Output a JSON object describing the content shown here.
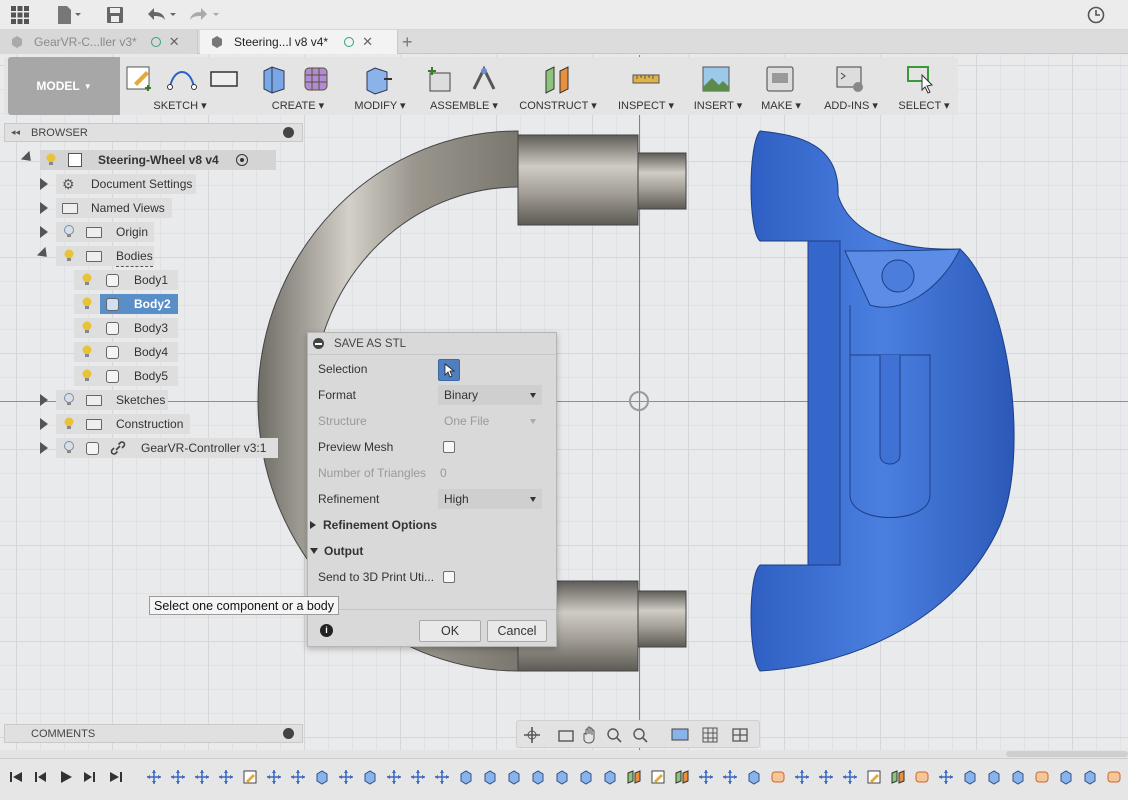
{
  "tabs": [
    {
      "label": "GearVR-C...ller v3*",
      "state": "inactive"
    },
    {
      "label": "Steering...l v8 v4*",
      "state": "active"
    }
  ],
  "toolbar": {
    "mode_label": "MODEL",
    "groups": [
      "SKETCH",
      "CREATE",
      "MODIFY",
      "ASSEMBLE",
      "CONSTRUCT",
      "INSPECT",
      "INSERT",
      "MAKE",
      "ADD-INS",
      "SELECT"
    ]
  },
  "browser": {
    "title": "BROWSER",
    "root": "Steering-Wheel v8 v4",
    "items": {
      "document_settings": "Document Settings",
      "named_views": "Named Views",
      "origin": "Origin",
      "bodies": "Bodies",
      "body1": "Body1",
      "body2": "Body2",
      "body3": "Body3",
      "body4": "Body4",
      "body5": "Body5",
      "sketches": "Sketches",
      "construction": "Construction",
      "gearvr": "GearVR-Controller v3:1"
    }
  },
  "comments": {
    "title": "COMMENTS"
  },
  "dialog": {
    "title": "SAVE AS STL",
    "selection_label": "Selection",
    "format_label": "Format",
    "format_value": "Binary",
    "structure_label": "Structure",
    "structure_value": "One File",
    "preview_mesh_label": "Preview Mesh",
    "preview_mesh_checked": false,
    "triangles_label": "Number of Triangles",
    "triangles_value": "0",
    "refinement_label": "Refinement",
    "refinement_value": "High",
    "refinement_options_label": "Refinement Options",
    "output_label": "Output",
    "send_3d_label": "Send to 3D Print Uti...",
    "send_3d_checked": false,
    "ok_label": "OK",
    "cancel_label": "Cancel"
  },
  "tooltip": {
    "text": "Select one component or a body"
  },
  "colors": {
    "selection_blue": "#3f73d6",
    "metal_gray": "#8d8a82",
    "highlight": "#5a8ec7"
  }
}
